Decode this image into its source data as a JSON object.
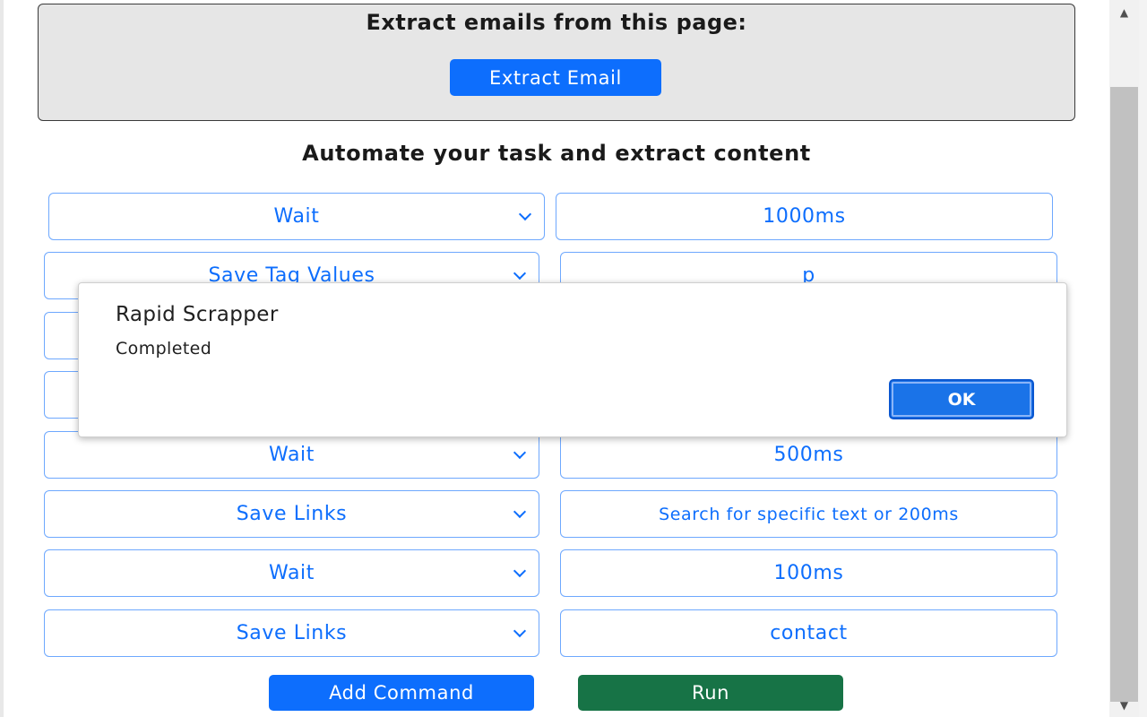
{
  "email_section": {
    "title": "Extract emails from this page:",
    "button_label": "Extract Email"
  },
  "automation": {
    "title": "Automate your task and extract content",
    "rows": [
      {
        "command": "Wait",
        "value": "1000ms"
      },
      {
        "command": "Save Tag Values",
        "value": "p"
      },
      {
        "command": "",
        "value": ""
      },
      {
        "command": "",
        "value": ""
      },
      {
        "command": "Wait",
        "value": "500ms"
      },
      {
        "command": "Save Links",
        "value": "Search for specific text or 200ms"
      },
      {
        "command": "Wait",
        "value": "100ms"
      },
      {
        "command": "Save Links",
        "value": "contact"
      }
    ],
    "add_command_label": "Add Command",
    "run_label": "Run"
  },
  "dialog": {
    "title": "Rapid Scrapper",
    "message": "Completed",
    "ok_label": "OK"
  },
  "scrollbar": {
    "up_icon": "▲",
    "down_icon": "▼"
  },
  "colors": {
    "primary": "#0d6efd",
    "run": "#177346",
    "dialog_ok": "#1a73e8"
  }
}
